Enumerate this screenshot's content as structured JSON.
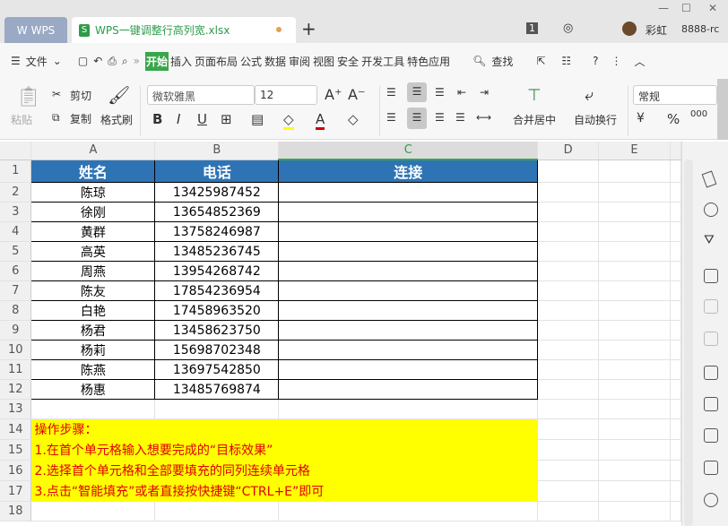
{
  "titlebar": {
    "wps_tab": "WPS",
    "doc_tab": "WPS一键调整行高列宽.xlsx",
    "new_tab": "+",
    "badge": "1",
    "user": "彩虹",
    "account": "8888-rc",
    "window_buttons": [
      "—",
      "☐",
      "✕"
    ]
  },
  "menu": {
    "file": "文件",
    "tabs": [
      "开始",
      "插入",
      "页面布局",
      "公式",
      "数据",
      "审阅",
      "视图",
      "安全",
      "开发工具",
      "特色应用"
    ],
    "search": "查找"
  },
  "ribbon": {
    "paste": "粘贴",
    "cut": "剪切",
    "copy": "复制",
    "format_painter": "格式刷",
    "font_name": "微软雅黑",
    "font_size": "12",
    "merge": "合并居中",
    "wrap": "自动换行",
    "number_format": "常规",
    "bold": "B",
    "italic": "I",
    "underline": "U"
  },
  "grid": {
    "columns": [
      "A",
      "B",
      "C",
      "D",
      "E"
    ],
    "header": [
      "姓名",
      "电话",
      "连接"
    ],
    "rows": [
      [
        "陈琼",
        "13425987452"
      ],
      [
        "徐刚",
        "13654852369"
      ],
      [
        "黄群",
        "13758246987"
      ],
      [
        "高英",
        "13485236745"
      ],
      [
        "周燕",
        "13954268742"
      ],
      [
        "陈友",
        "17854236954"
      ],
      [
        "白艳",
        "17458963520"
      ],
      [
        "杨君",
        "13458623750"
      ],
      [
        "杨莉",
        "15698702348"
      ],
      [
        "陈燕",
        "13697542850"
      ],
      [
        "杨惠",
        "13485769874"
      ]
    ],
    "notes": [
      "操作步骤：",
      "1.在首个单元格输入想要完成的“目标效果”",
      "2.选择首个单元格和全部要填充的同列连续单元格",
      "3.点击“智能填充”或者直接按快捷键“CTRL+E”即可"
    ]
  }
}
